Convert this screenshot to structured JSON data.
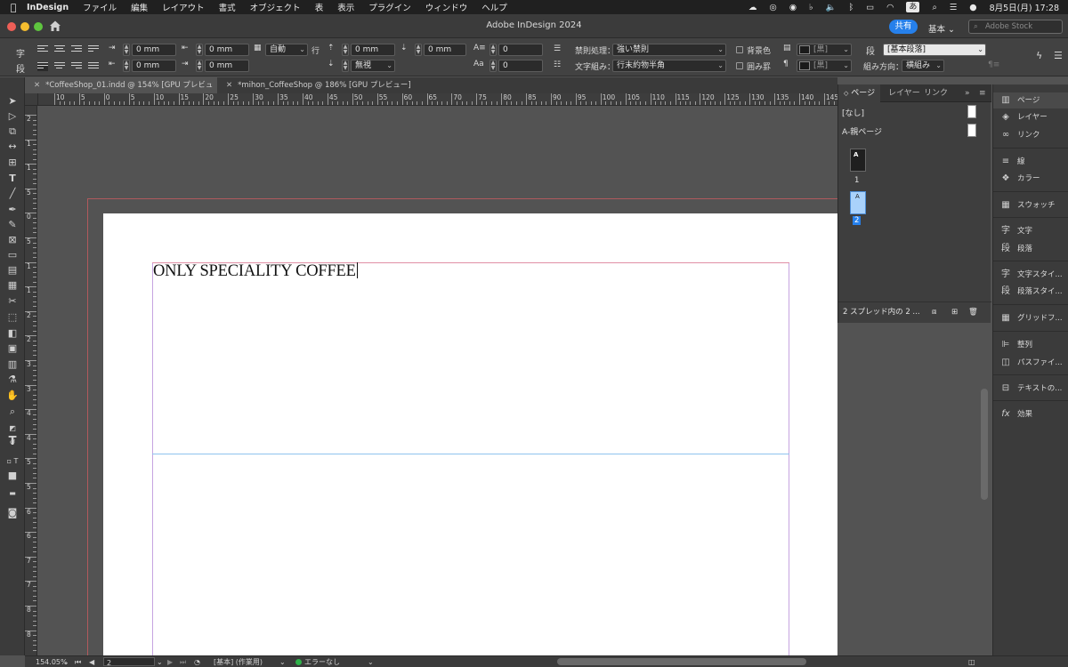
{
  "menubar": {
    "app_name": "InDesign",
    "items": [
      "ファイル",
      "編集",
      "レイアウト",
      "書式",
      "オブジェクト",
      "表",
      "表示",
      "プラグイン",
      "ウィンドウ",
      "ヘルプ"
    ],
    "ime": "あ",
    "datetime": "8月5日(月)  17:28"
  },
  "titlebar": {
    "title": "Adobe InDesign 2024",
    "share_label": "共有",
    "workspace_label": "基本 ⌄",
    "stock_placeholder": "Adobe Stock"
  },
  "control_panel": {
    "left_indent": "0 mm",
    "right_indent": "0 mm",
    "first_line_indent": "0 mm",
    "last_line_indent": "0 mm",
    "leading": "自動",
    "leading_unit": "行",
    "space_before": "0 mm",
    "space_after": "0 mm",
    "grid_align": "無視",
    "drop_cap_lines": "0",
    "drop_cap_chars": "0",
    "kinsoku_label": "禁則処理：",
    "kinsoku_value": "強い禁則",
    "mojikumi_label": "文字組み：",
    "mojikumi_value": "行末約物半角",
    "shading_label": "背景色",
    "border_label": "囲み罫",
    "swatch_1": "[黒]",
    "swatch_2": "[黒]",
    "paragraph_style": "[基本段落]",
    "composer_label": "組み方向：",
    "composer_value": "横組み",
    "para_icon_1": "段",
    "para_icon_2": "段",
    "char_icon": "字"
  },
  "tabs": [
    {
      "label": "*CoffeeShop_01.indd @ 154% [GPU プレビュー]"
    },
    {
      "label": "*mihon_CoffeeShop @ 186% [GPU プレビュー]"
    }
  ],
  "ruler": {
    "h_ticks": [
      "10",
      "5",
      "0",
      "5",
      "10",
      "15",
      "20",
      "25",
      "30",
      "35",
      "40",
      "45",
      "50",
      "55",
      "60",
      "65",
      "70",
      "75",
      "80",
      "85",
      "90",
      "95",
      "100",
      "105",
      "110",
      "115",
      "120",
      "125",
      "130",
      "135",
      "140",
      "145"
    ],
    "v_ticks": [
      "2",
      "1",
      "1",
      "5",
      "0",
      "5",
      "1",
      "1",
      "2",
      "2",
      "3",
      "3",
      "4",
      "4",
      "5",
      "5",
      "6",
      "6",
      "7",
      "7",
      "8",
      "8"
    ]
  },
  "document": {
    "text": "ONLY SPECIALITY COFFEE"
  },
  "pages_panel": {
    "tabs": [
      "ページ",
      "レイヤー",
      "リンク"
    ],
    "none_label": "[なし]",
    "parent_label": "A-親ページ",
    "page1_prefix": "A",
    "page1_num": "1",
    "page2_prefix": "A",
    "page2_num": "2",
    "footer": "2 スプレッド内の 2 ..."
  },
  "dock": {
    "items": [
      "ページ",
      "レイヤー",
      "リンク",
      "線",
      "カラー",
      "スウォッチ",
      "文字",
      "段落",
      "文字スタイ...",
      "段落スタイ...",
      "グリッドフ...",
      "整列",
      "パスファイ...",
      "テキストの...",
      "効果"
    ]
  },
  "statusbar": {
    "zoom": "154.05%",
    "page": "2",
    "profile": "[基本] (作業用)",
    "errors": "エラーなし"
  },
  "colors": {
    "accent": "#2680eb",
    "status_ok": "#2fb24a",
    "bleed": "#b0595d",
    "guide": "#8fc3ee"
  }
}
